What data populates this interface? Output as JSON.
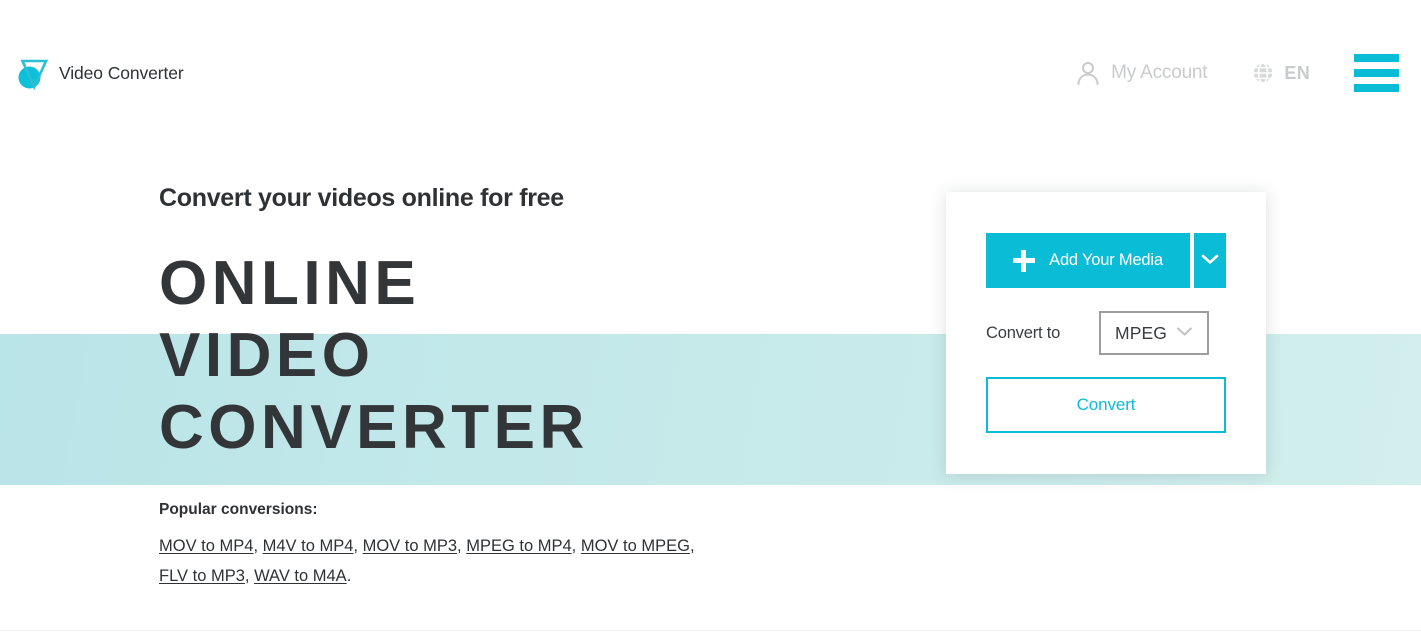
{
  "header": {
    "brand": {
      "name": "Video Converter",
      "logo_icon": "triangle-circle-logo-icon",
      "logo_color": "#0bbcd6"
    },
    "account": {
      "label": "My Account",
      "icon": "person-icon"
    },
    "language": {
      "label": "EN",
      "icon": "globe-icon"
    },
    "menu": {
      "icon": "hamburger-menu-icon",
      "color": "#0bbcd6"
    }
  },
  "hero": {
    "kicker": "Convert your videos online for free",
    "title_line_1": "ONLINE",
    "title_line_2": "VIDEO",
    "title_line_3": "CONVERTER",
    "band_color": "#c3e7ea"
  },
  "popular": {
    "title": "Popular conversions:",
    "links": [
      "MOV to MP4",
      "M4V to MP4",
      "MOV to MP3",
      "MPEG to MP4",
      "MOV to MPEG",
      "FLV to MP3",
      "WAV to M4A"
    ],
    "separator": ", ",
    "terminator": "."
  },
  "converter": {
    "add_media": {
      "label": "Add Your Media",
      "plus_icon": "plus-icon",
      "caret_icon": "chevron-down-icon",
      "color": "#0bbcd6"
    },
    "convert_to": {
      "label": "Convert to",
      "selected": "MPEG",
      "caret_icon": "chevron-down-icon",
      "options": [
        "MPEG"
      ]
    },
    "convert_button": {
      "label": "Convert",
      "color": "#0bbcd6"
    }
  }
}
